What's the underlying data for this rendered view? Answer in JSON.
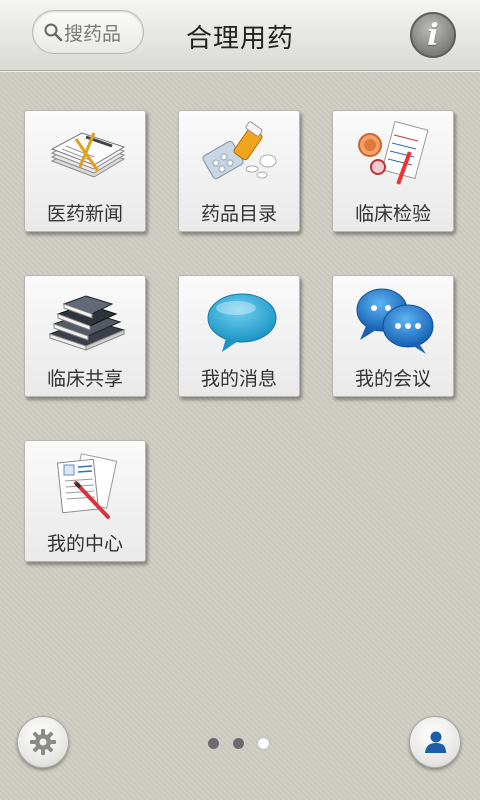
{
  "header": {
    "search_label": "搜药品",
    "title": "合理用药",
    "info_label": "i"
  },
  "tiles": [
    {
      "label": "医药新闻",
      "icon": "newspaper-icon"
    },
    {
      "label": "药品目录",
      "icon": "medicine-icon"
    },
    {
      "label": "临床检验",
      "icon": "lab-test-icon"
    },
    {
      "label": "临床共享",
      "icon": "books-icon"
    },
    {
      "label": "我的消息",
      "icon": "message-bubble-icon"
    },
    {
      "label": "我的会议",
      "icon": "chat-bubbles-icon"
    },
    {
      "label": "我的中心",
      "icon": "medical-forms-icon"
    }
  ],
  "pager": {
    "count": 3,
    "active_index": 2
  },
  "bottom": {
    "settings_icon": "gear-icon",
    "profile_icon": "user-icon"
  },
  "colors": {
    "message_blue": "#2ea6d8",
    "chat_blue": "#1f74c9"
  }
}
